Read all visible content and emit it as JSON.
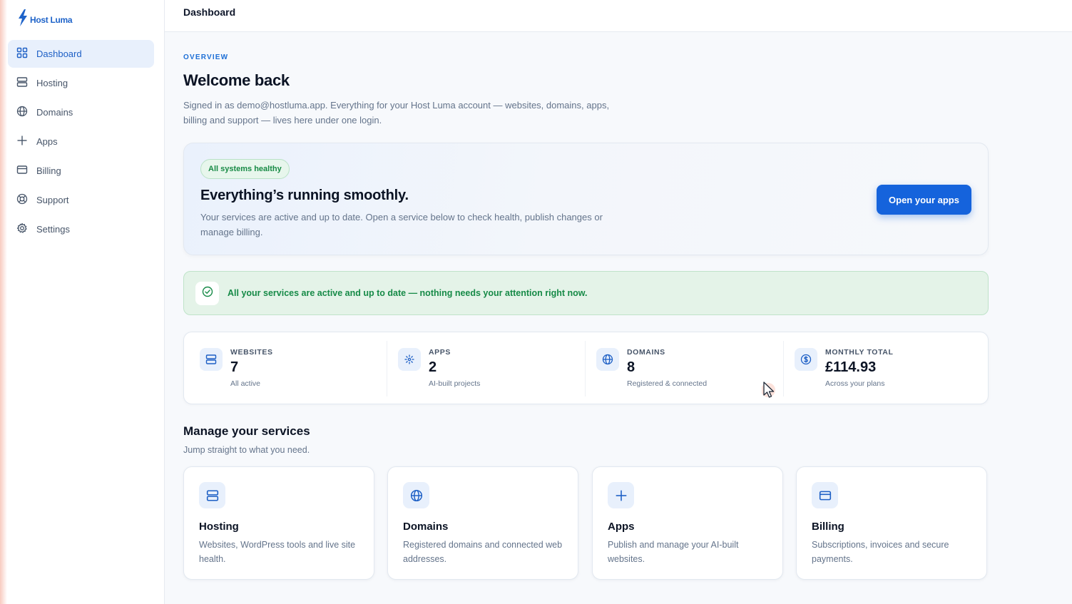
{
  "app": {
    "brand": "Host Luma"
  },
  "colors": {
    "accent": "#1563dc",
    "success": "#168a47",
    "sidebar_active_bg": "#e8f0fc"
  },
  "sidebar": {
    "items": [
      {
        "label": "Dashboard",
        "icon": "grid-icon",
        "active": true
      },
      {
        "label": "Hosting",
        "icon": "server-icon"
      },
      {
        "label": "Domains",
        "icon": "globe-icon"
      },
      {
        "label": "Apps",
        "icon": "sparkle-icon"
      },
      {
        "label": "Billing",
        "icon": "credit-card-icon"
      },
      {
        "label": "Support",
        "icon": "lifebuoy-icon"
      },
      {
        "label": "Settings",
        "icon": "gear-icon"
      }
    ]
  },
  "header": {
    "title": "Dashboard"
  },
  "overview": {
    "eyebrow": "OVERVIEW",
    "title": "Welcome back",
    "intro": "Signed in as demo@hostluma.app. Everything for your Host Luma account — websites, domains, apps, billing and support — lives here under one login."
  },
  "hero": {
    "badge": "All systems healthy",
    "title": "Everything’s running smoothly.",
    "text": "Your services are active and up to date. Open a service below to check health, publish changes or manage billing.",
    "button": "Open your apps"
  },
  "alert": {
    "text": "All your services are active and up to date — nothing needs your attention right now."
  },
  "stats": [
    {
      "label": "WEBSITES",
      "value": "7",
      "sub": "All active",
      "icon": "server-icon"
    },
    {
      "label": "APPS",
      "value": "2",
      "sub": "AI-built projects",
      "icon": "sparkle-icon"
    },
    {
      "label": "DOMAINS",
      "value": "8",
      "sub": "Registered & connected",
      "icon": "globe-icon"
    },
    {
      "label": "MONTHLY TOTAL",
      "value": "£114.93",
      "sub": "Across your plans",
      "icon": "dollar-icon"
    }
  ],
  "manage": {
    "title": "Manage your services",
    "subtitle": "Jump straight to what you need.",
    "cards": [
      {
        "title": "Hosting",
        "text": "Websites, WordPress tools and live site health.",
        "icon": "server-icon"
      },
      {
        "title": "Domains",
        "text": "Registered domains and connected web addresses.",
        "icon": "globe-icon"
      },
      {
        "title": "Apps",
        "text": "Publish and manage your AI-built websites.",
        "icon": "sparkle-icon"
      },
      {
        "title": "Billing",
        "text": "Subscriptions, invoices and secure payments.",
        "icon": "credit-card-icon"
      }
    ]
  }
}
